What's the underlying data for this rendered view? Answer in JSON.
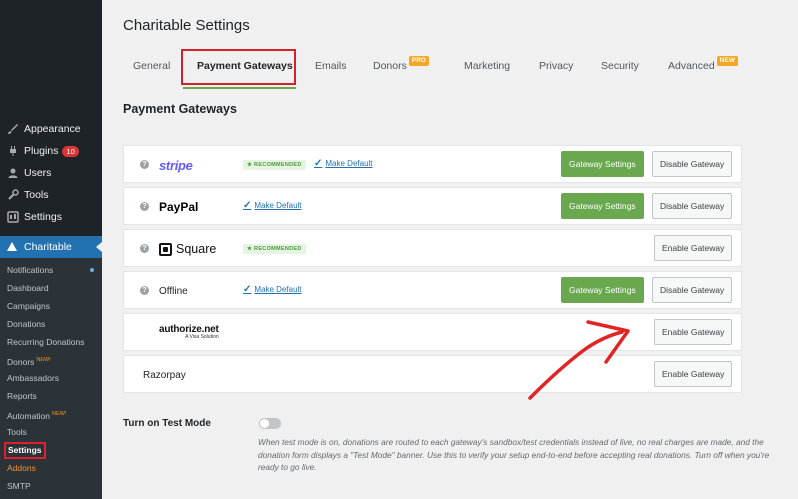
{
  "sidebar": {
    "items": [
      {
        "label": "Appearance",
        "icon": "brush-icon"
      },
      {
        "label": "Plugins",
        "icon": "plug-icon",
        "count": "10"
      },
      {
        "label": "Users",
        "icon": "user-icon"
      },
      {
        "label": "Tools",
        "icon": "wrench-icon"
      },
      {
        "label": "Settings",
        "icon": "settings-icon"
      }
    ],
    "active": {
      "label": "Charitable",
      "icon": "charitable-icon"
    },
    "submenu": [
      {
        "label": "Notifications"
      },
      {
        "label": "Dashboard"
      },
      {
        "label": "Campaigns"
      },
      {
        "label": "Donations"
      },
      {
        "label": "Recurring Donations"
      },
      {
        "label": "Donors",
        "tag": "NEW!"
      },
      {
        "label": "Ambassadors"
      },
      {
        "label": "Reports"
      },
      {
        "label": "Automation",
        "tag": "NEW!"
      },
      {
        "label": "Tools"
      },
      {
        "label": "Settings"
      },
      {
        "label": "Addons"
      },
      {
        "label": "SMTP"
      }
    ]
  },
  "page": {
    "title": "Charitable Settings",
    "tabs": [
      {
        "label": "General"
      },
      {
        "label": "Payment Gateways"
      },
      {
        "label": "Emails"
      },
      {
        "label": "Donors",
        "badge": "PRO"
      },
      {
        "label": "Marketing"
      },
      {
        "label": "Privacy"
      },
      {
        "label": "Security"
      },
      {
        "label": "Advanced",
        "badge": "NEW"
      }
    ],
    "section_title": "Payment Gateways"
  },
  "gateways": [
    {
      "name": "stripe",
      "recommended": "★ RECOMMENDED",
      "make_default": "Make Default",
      "settings_btn": "Gateway Settings",
      "toggle_btn": "Disable Gateway"
    },
    {
      "name": "PayPal",
      "make_default": "Make Default",
      "settings_btn": "Gateway Settings",
      "toggle_btn": "Disable Gateway"
    },
    {
      "name": "Square",
      "recommended": "★ RECOMMENDED",
      "toggle_btn": "Enable Gateway"
    },
    {
      "name": "Offline",
      "make_default": "Make Default",
      "settings_btn": "Gateway Settings",
      "toggle_btn": "Disable Gateway"
    },
    {
      "name": "authorize.net",
      "sub": "A Visa Solution",
      "toggle_btn": "Enable Gateway"
    },
    {
      "name": "Razorpay",
      "toggle_btn": "Enable Gateway"
    }
  ],
  "test_mode": {
    "label": "Turn on Test Mode",
    "description": "When test mode is on, donations are routed to each gateway's sandbox/test credentials instead of live, no real charges are made, and the donation form displays a \"Test Mode\" banner. Use this to verify your setup end-to-end before accepting real donations. Turn off when you're ready to go live."
  },
  "colors": {
    "accent_green": "#6aa84f",
    "highlight_red": "#d42028",
    "link_blue": "#2271b1",
    "sidebar_bg": "#1d2327"
  }
}
